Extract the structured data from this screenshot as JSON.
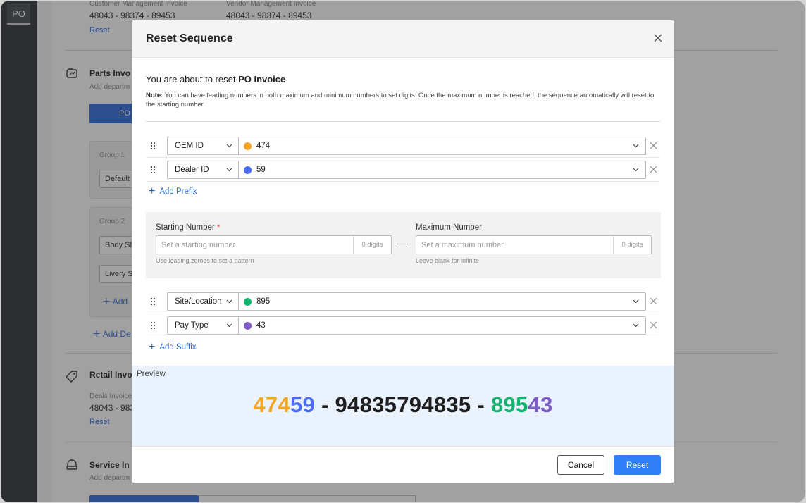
{
  "rail": {
    "tab_label": "PO"
  },
  "background": {
    "top_section": {
      "customer_label": "Customer Management Invoice",
      "customer_value": "48043 - 98374 - 89453",
      "vendor_label": "Vendor Management Invoice",
      "vendor_value": "48043 - 98374 - 89453",
      "reset_link": "Reset"
    },
    "parts_section": {
      "title": "Parts Invo",
      "subtitle": "Add departm",
      "button_label": "PO",
      "group1_label": "Group 1",
      "group1_input": "Default",
      "group2_label": "Group 2",
      "group2_input1": "Body Sh",
      "group2_input2": "Livery S",
      "add_link": "Add",
      "add_de_link": "Add De"
    },
    "retail_section": {
      "title": "Retail Invo",
      "label": "Deals Invoice",
      "value": "48043 - 983",
      "reset_link": "Reset"
    },
    "service_section": {
      "title": "Service In",
      "subtitle": "Add departm"
    }
  },
  "modal": {
    "title": "Reset Sequence",
    "intro_prefix": "You are about to reset ",
    "intro_target": "PO Invoice",
    "note_label": "Note:",
    "note_text": " You can have leading numbers in both maximum and minimum numbers to set digits. Once the maximum number is reached, the sequence automatically will reset to the starting number",
    "prefix_rows": [
      {
        "field": "OEM ID",
        "value": "474",
        "color": "#f5a623"
      },
      {
        "field": "Dealer ID",
        "value": "59",
        "color": "#4a6cf0"
      }
    ],
    "add_prefix": "Add Prefix",
    "starting_number": {
      "label": "Starting Number",
      "required_mark": "*",
      "placeholder": "Set a starting number",
      "digits": "0 digits",
      "hint": "Use leading zeroes to set a pattern"
    },
    "maximum_number": {
      "label": "Maximum Number",
      "placeholder": "Set a maximum number",
      "digits": "0 digits",
      "hint": "Leave blank for infinite"
    },
    "suffix_rows": [
      {
        "field": "Site/Location",
        "value": "895",
        "color": "#14b46e"
      },
      {
        "field": "Pay Type",
        "value": "43",
        "color": "#7d5cc6"
      }
    ],
    "add_suffix": "Add Suffix",
    "preview": {
      "label": "Preview",
      "parts": [
        {
          "text": "474",
          "color": "#f5a623"
        },
        {
          "text": "59",
          "color": "#4a6cf0"
        },
        {
          "text": " - ",
          "color": "#1e1e1e"
        },
        {
          "text": "94835794835",
          "color": "#1e1e1e"
        },
        {
          "text": " - ",
          "color": "#1e1e1e"
        },
        {
          "text": "895",
          "color": "#14b46e"
        },
        {
          "text": "43",
          "color": "#7d5cc6"
        }
      ]
    },
    "cancel_label": "Cancel",
    "reset_label": "Reset"
  }
}
